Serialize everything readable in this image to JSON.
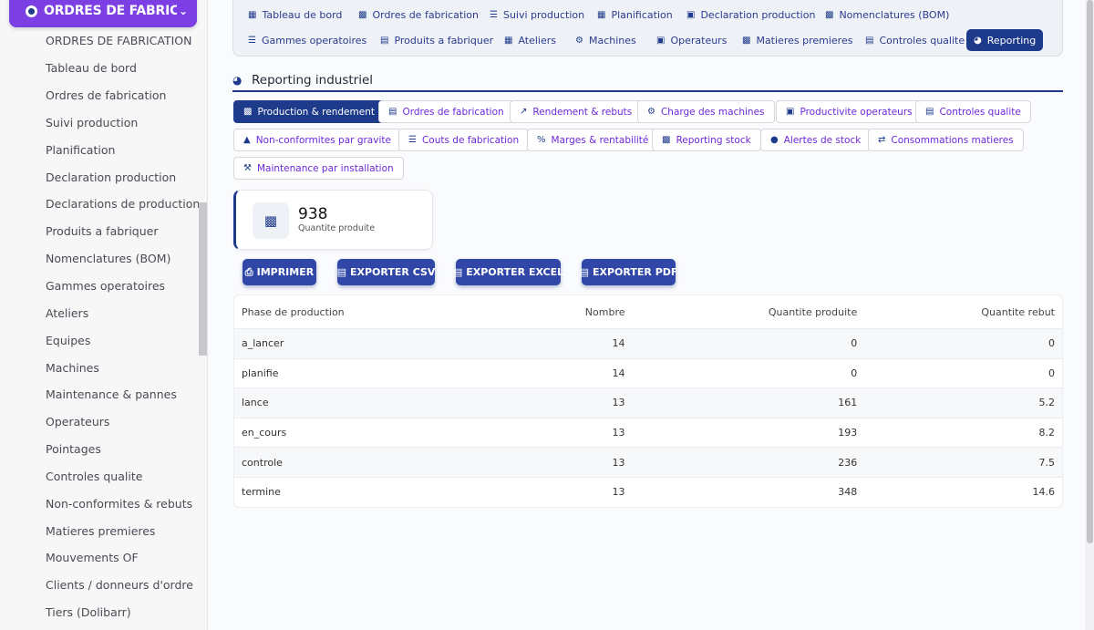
{
  "sidebar": {
    "app_title": "ORDRES DE FABRICATION",
    "items": [
      "ORDRES DE FABRICATION",
      "Tableau de bord",
      "Ordres de fabrication",
      "Suivi production",
      "Planification",
      "Declaration production",
      "Declarations de production",
      "Produits a fabriquer",
      "Nomenclatures (BOM)",
      "Gammes operatoires",
      "Ateliers",
      "Equipes",
      "Machines",
      "Maintenance & pannes",
      "Operateurs",
      "Pointages",
      "Controles qualite",
      "Non-conformites & rebuts",
      "Matieres premieres",
      "Mouvements OF",
      "Clients / donneurs d'ordre",
      "Tiers (Dolibarr)"
    ]
  },
  "topnav": {
    "row1": [
      "Tableau de bord",
      "Ordres de fabrication",
      "Suivi production",
      "Planification",
      "Declaration production",
      "Nomenclatures (BOM)"
    ],
    "row2": [
      "Gammes operatoires",
      "Produits a fabriquer",
      "Ateliers",
      "Machines",
      "Operateurs",
      "Matieres premieres",
      "Controles qualite",
      "Reporting"
    ],
    "active": "Reporting"
  },
  "section": {
    "title": "Reporting industriel"
  },
  "tabs": {
    "row1": [
      "Production & rendement",
      "Ordres de fabrication",
      "Rendement & rebuts",
      "Charge des machines",
      "Productivite operateurs",
      "Controles qualite"
    ],
    "row2": [
      "Non-conformites par gravite",
      "Couts de fabrication",
      "Marges & rentabilité",
      "Reporting stock",
      "Alertes de stock",
      "Consommations matieres"
    ],
    "row3": [
      "Maintenance par installation"
    ],
    "active": "Production & rendement"
  },
  "kpi": {
    "value": "938",
    "label": "Quantite produite"
  },
  "exports": [
    "IMPRIMER",
    "EXPORTER CSV",
    "EXPORTER EXCEL",
    "EXPORTER PDF"
  ],
  "table": {
    "headers": [
      "Phase de production",
      "Nombre",
      "Quantite produite",
      "Quantite rebut"
    ],
    "rows": [
      [
        "a_lancer",
        "14",
        "0",
        "0"
      ],
      [
        "planifie",
        "14",
        "0",
        "0"
      ],
      [
        "lance",
        "13",
        "161",
        "5.2"
      ],
      [
        "en_cours",
        "13",
        "193",
        "8.2"
      ],
      [
        "controle",
        "13",
        "236",
        "7.5"
      ],
      [
        "termine",
        "13",
        "348",
        "14.6"
      ]
    ]
  }
}
